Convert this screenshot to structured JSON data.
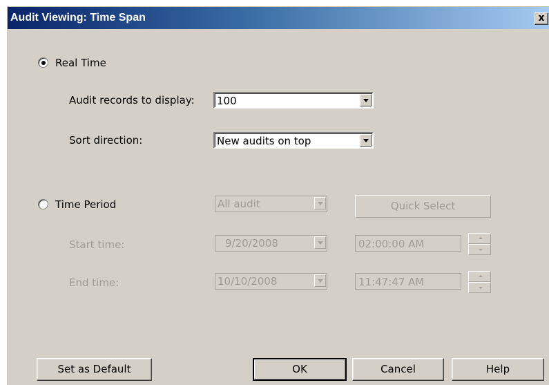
{
  "window": {
    "title": "Audit Viewing: Time Span",
    "close_glyph": "x"
  },
  "real_time": {
    "label": "Real Time",
    "selected": true,
    "records_label": "Audit records to display:",
    "records_value": "100",
    "sort_label": "Sort direction:",
    "sort_value": "New audits on top"
  },
  "time_period": {
    "label": "Time Period",
    "selected": false,
    "range_value": "All audit",
    "quick_select_label": "Quick Select",
    "start_label": "Start time:",
    "start_date": "9/20/2008",
    "start_time": "02:00:00 AM",
    "end_label": "End time:",
    "end_date": "10/10/2008",
    "end_time": "11:47:47 AM"
  },
  "buttons": {
    "set_default": "Set as Default",
    "ok": "OK",
    "cancel": "Cancel",
    "help": "Help"
  }
}
